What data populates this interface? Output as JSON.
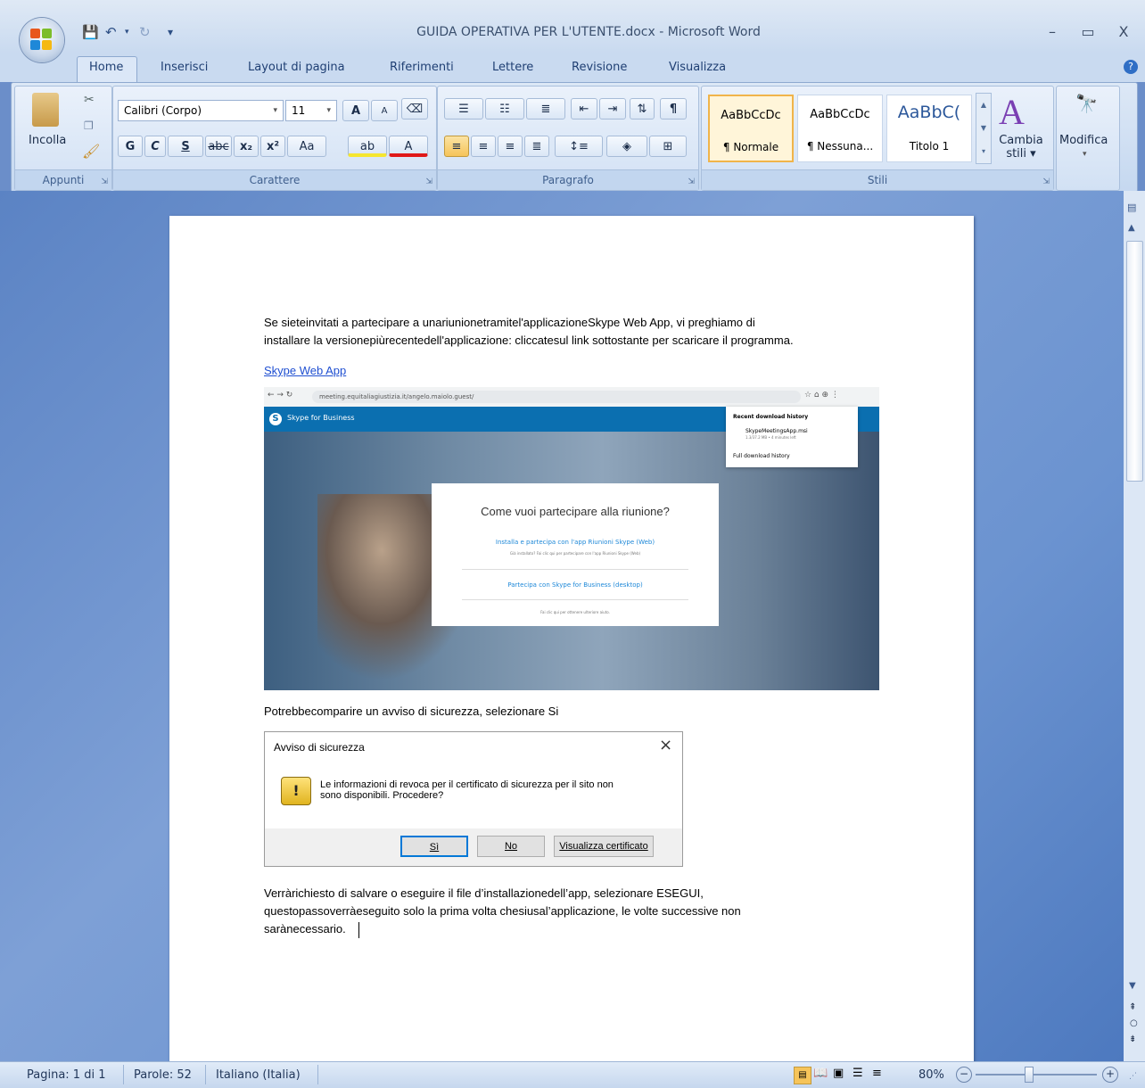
{
  "window": {
    "title": "GUIDA OPERATIVA PER L'UTENTE.docx - Microsoft Word",
    "minimize": "–",
    "maximize": "▭",
    "close": "X"
  },
  "tabs": [
    "Home",
    "Inserisci",
    "Layout di pagina",
    "Riferimenti",
    "Lettere",
    "Revisione",
    "Visualizza"
  ],
  "ribbon": {
    "clipboard": {
      "paste": "Incolla",
      "label": "Appunti"
    },
    "font": {
      "name": "Calibri (Corpo)",
      "size": "11",
      "label": "Carattere",
      "bold": "G",
      "italic": "C",
      "underline": "S",
      "strike": "abc",
      "subscript": "x₂",
      "superscript": "x²",
      "case": "Aa",
      "grow": "A",
      "shrink": "A",
      "font_color": "A"
    },
    "paragraph": {
      "label": "Paragrafo"
    },
    "styles": {
      "label": "Stili",
      "items": [
        {
          "sample": "AaBbCcDc",
          "name": "¶ Normale"
        },
        {
          "sample": "AaBbCcDc",
          "name": "¶ Nessuna..."
        },
        {
          "sample": "AaBbC(",
          "name": "Titolo 1"
        }
      ],
      "change": "Cambia stili",
      "change_line1": "Cambia",
      "change_line2": "stili ▾"
    },
    "editing": {
      "label": "Modifica"
    }
  },
  "document": {
    "para1_line1": "Se sieteinvitati a partecipare a unariunionetramitel'applicazioneSkype Web App, vi preghiamo di",
    "para1_line2": "installare la versionepiùrecentedell'applicazione: cliccatesul link sottostante per scaricare il programma.",
    "link": "Skype Web App",
    "para2": "Potrebbecomparire un avviso di sicurezza, selezionare Si",
    "para3_line1": "Verràrichiesto di salvare o eseguire il file d’installazionedell’app, selezionare ESEGUI,",
    "para3_line2": "questopassoverràeseguito solo la prima volta chesiusal’applicazione, le volte successive non",
    "para3_line3": "sarànecessario."
  },
  "screenshot": {
    "url": "meeting.equitaliagiustizia.it/angelo.maiolo.guest/",
    "brand": "Skype for Business",
    "dialog_title": "Come vuoi partecipare alla riunione?",
    "option1": "Installa e partecipa con l'app Riunioni Skype (Web)",
    "option1_sub": "Già installato? Fai clic qui per partecipare con l'app Riunioni Skype (Web)",
    "option2": "Partecipa con Skype for Business (desktop)",
    "footer": "Fai clic qui per ottenere ulteriore aiuto.",
    "download_title": "Recent download history",
    "download_file": "SkypeMeetingsApp.msi",
    "download_meta": "1.3/37.2 MB • 4 minutes left",
    "download_full": "Full download history"
  },
  "security_dialog": {
    "title": "Avviso di sicurezza",
    "message_line1": "Le informazioni di revoca per il certificato di sicurezza per il sito non",
    "message_line2": "sono disponibili. Procedere?",
    "yes": "Sì",
    "no": "No",
    "view": "Visualizza certificato"
  },
  "status": {
    "page": "Pagina: 1 di 1",
    "words": "Parole: 52",
    "language": "Italiano (Italia)",
    "zoom": "80%"
  },
  "colors": {
    "accent": "#1f4fd1",
    "skype_blue": "#0b6fb0"
  }
}
